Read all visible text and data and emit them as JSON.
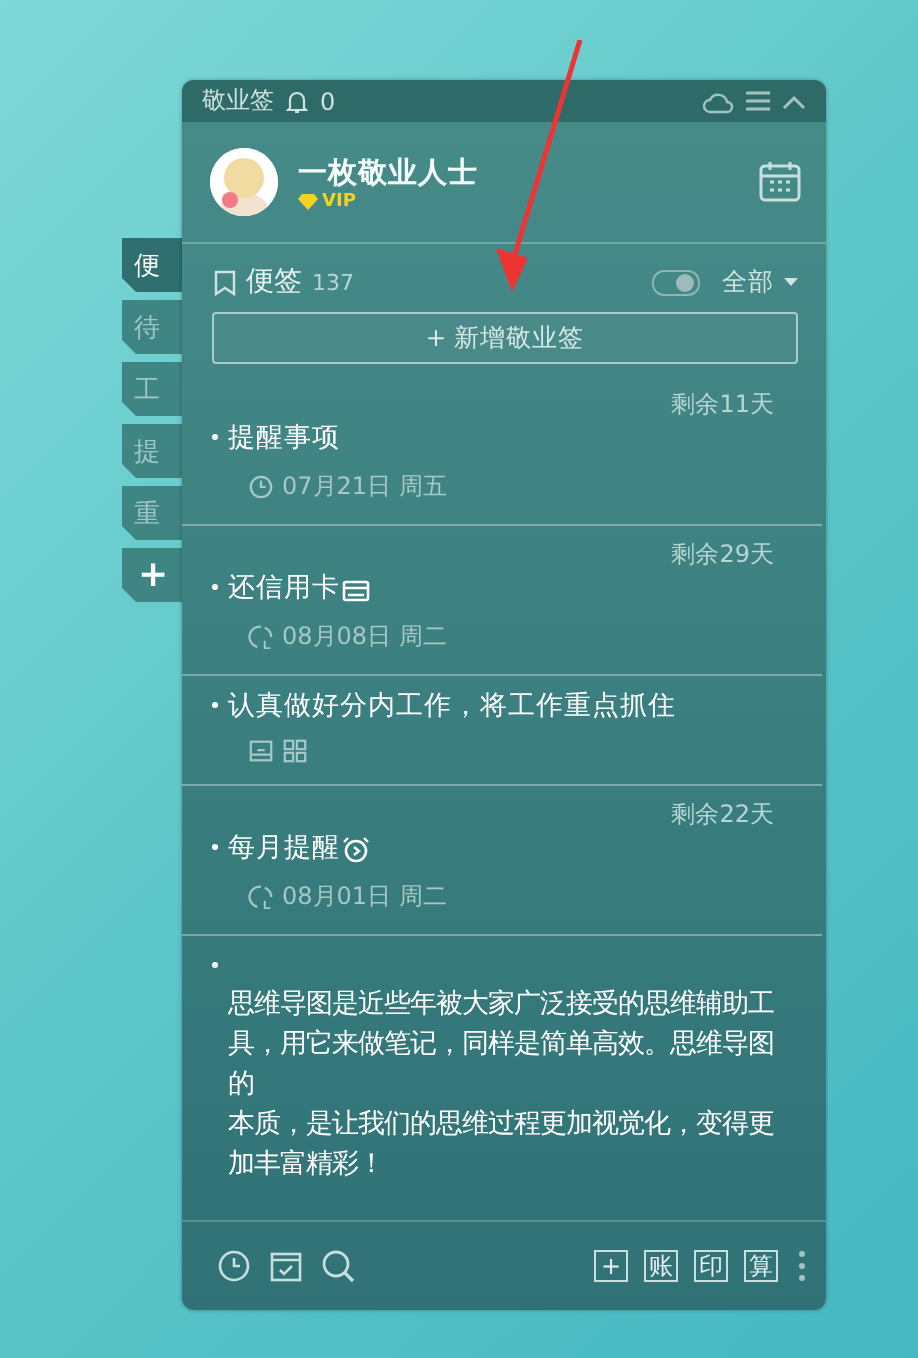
{
  "side_tabs": [
    {
      "label": "便",
      "selected": true
    },
    {
      "label": "待",
      "selected": false
    },
    {
      "label": "工",
      "selected": false
    },
    {
      "label": "提",
      "selected": false
    },
    {
      "label": "重",
      "selected": false
    },
    {
      "label": "+",
      "selected": false
    }
  ],
  "header": {
    "title": "敬业签",
    "bell_count": "0"
  },
  "profile": {
    "name": "一枚敬业人士",
    "badge": "VIP"
  },
  "section": {
    "title": "便签",
    "count": "137",
    "filter": "全部",
    "filter_toggle": {
      "on": true
    }
  },
  "add_button": "+ 新增敬业签",
  "notes": [
    {
      "kind": "reminder",
      "remaining": "剩余11天",
      "text": "提醒事项",
      "date": "07月21日 周五"
    },
    {
      "kind": "repeat",
      "remaining": "剩余29天",
      "text": "还信用卡",
      "date": "08月08日 周二"
    },
    {
      "kind": "attachments",
      "text": "认真做好分内工作，将工作重点抓住"
    },
    {
      "kind": "repeat",
      "remaining": "剩余22天",
      "text": "每月提醒",
      "date": "08月01日 周二"
    },
    {
      "kind": "paragraphs",
      "paragraphs": [
        "思维导图是近些年被大家广泛接受的思维辅助工具，用它来做笔记，同样是简单高效。思维导图的",
        "本质，是让我们的思维过程更加视觉化，变得更加丰富精彩！"
      ]
    }
  ],
  "footer_buttons": [
    "+",
    "账",
    "印",
    "算"
  ]
}
